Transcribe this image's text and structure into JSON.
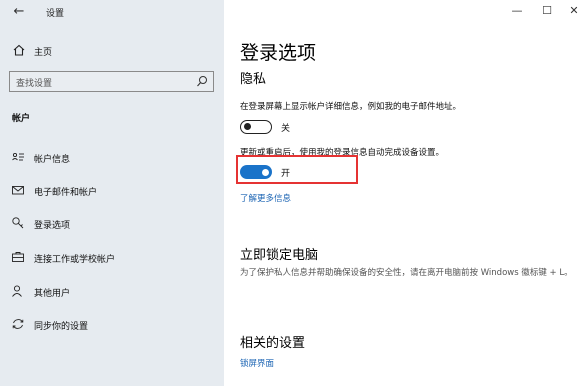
{
  "window": {
    "title": "设置",
    "back_glyph": "←",
    "minimize_glyph": "—",
    "maximize_glyph": "☐",
    "close_glyph": "✕"
  },
  "sidebar": {
    "home_label": "主页",
    "search_placeholder": "查找设置",
    "section_title": "帐户",
    "items": [
      {
        "label": "帐户信息",
        "icon": "person-card-icon"
      },
      {
        "label": "电子邮件和帐户",
        "icon": "mail-icon"
      },
      {
        "label": "登录选项",
        "icon": "key-icon"
      },
      {
        "label": "连接工作或学校帐户",
        "icon": "briefcase-icon"
      },
      {
        "label": "其他用户",
        "icon": "person-add-icon"
      },
      {
        "label": "同步你的设置",
        "icon": "sync-icon"
      }
    ]
  },
  "main": {
    "title": "登录选项",
    "privacy_title": "隐私",
    "privacy_desc": "在登录屏幕上显示帐户详细信息，例如我的电子邮件地址。",
    "toggle1_state": "关",
    "toggle1_on": false,
    "restart_desc": "更新或重启后，使用我的登录信息自动完成设备设置。",
    "toggle2_state": "开",
    "toggle2_on": true,
    "learn_more": "了解更多信息",
    "lock_title": "立即锁定电脑",
    "lock_desc": "为了保护私人信息并帮助确保设备的安全性，请在离开电脑前按 Windows 徽标键 + L。",
    "related_title": "相关的设置",
    "lock_screen_link": "锁屏界面"
  },
  "colors": {
    "sidebar_bg": "#e6ebf0",
    "accent": "#1a73c9",
    "link": "#1a63b3",
    "highlight_border": "#e53333"
  }
}
